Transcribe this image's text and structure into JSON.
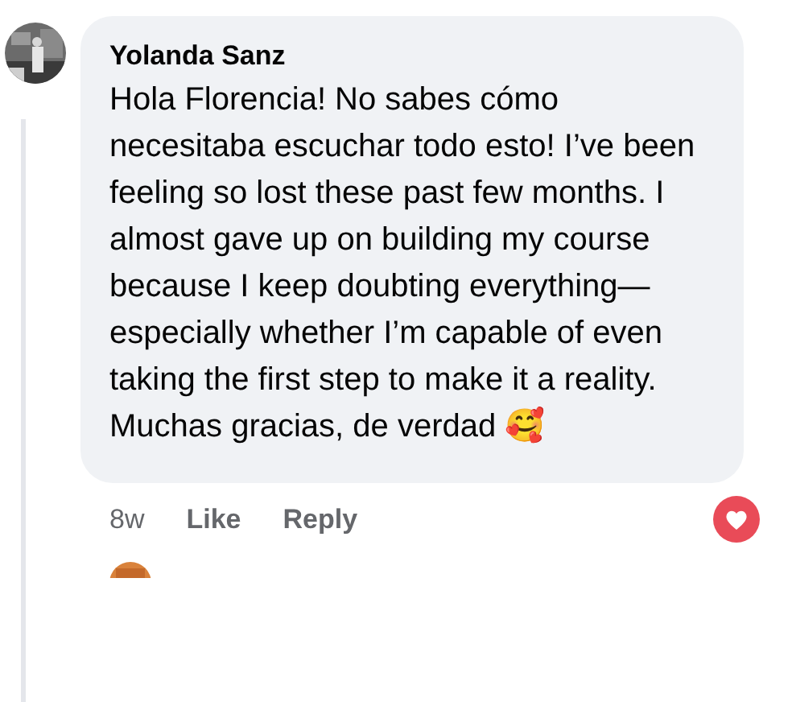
{
  "comment": {
    "author": "Yolanda Sanz",
    "text": "Hola Florencia! No sabes cómo necesitaba escuchar todo esto! I’ve been feeling so lost these past few months. I almost gave up on building my course because I keep doubting everything—especially whether I’m capable of even taking the first step to make it a reality. Muchas gracias, de verdad 🥰",
    "time": "8w",
    "actions": [
      "Like",
      "Reply"
    ],
    "reacted": true
  }
}
